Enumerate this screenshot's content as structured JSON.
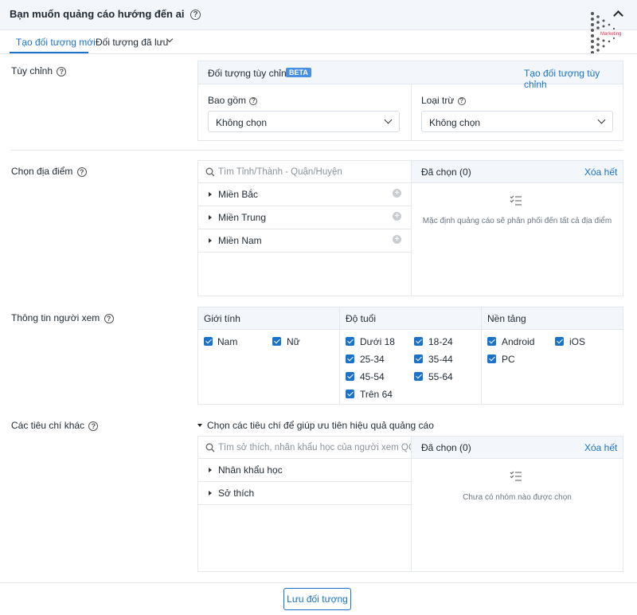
{
  "header": {
    "title": "Bạn muốn quảng cáo hướng đến ai",
    "logo_text": "Marketing"
  },
  "tabs": [
    {
      "label": "Tạo đối tượng mới"
    },
    {
      "label": "Đối tượng đã lưu"
    }
  ],
  "custom": {
    "label": "Tùy chỉnh",
    "panel_title": "Đối tượng tùy chỉnh",
    "badge": "BETA",
    "create_link": "Tạo đối tượng tùy chỉnh",
    "include_label": "Bao gồm",
    "include_value": "Không chọn",
    "exclude_label": "Loại trừ",
    "exclude_value": "Không chọn"
  },
  "location": {
    "label": "Chọn địa điểm",
    "search_placeholder": "Tìm Tỉnh/Thành - Quận/Huyện",
    "items": [
      "Miền Bắc",
      "Miền Trung",
      "Miền Nam"
    ],
    "selected_label": "Đã chọn (0)",
    "clear_label": "Xóa hết",
    "empty_text": "Mặc định quảng cáo sẽ phân phối đến tất cả địa điểm"
  },
  "viewer": {
    "label": "Thông tin người xem",
    "gender_title": "Giới tính",
    "genders": [
      "Nam",
      "Nữ"
    ],
    "age_title": "Độ tuổi",
    "ages": [
      "Dưới 18",
      "18-24",
      "25-34",
      "35-44",
      "45-54",
      "55-64",
      "Trên 64"
    ],
    "platform_title": "Nền tảng",
    "platforms": [
      "Android",
      "iOS",
      "PC"
    ]
  },
  "other": {
    "label": "Các tiêu chí khác",
    "toggle_text": "Chọn các tiêu chí để giúp ưu tiên hiệu quả quảng cáo",
    "search_placeholder": "Tìm sở thích, nhân khẩu học của người xem QC",
    "items": [
      "Nhân khẩu học",
      "Sở thích"
    ],
    "selected_label": "Đã chọn (0)",
    "clear_label": "Xóa hết",
    "empty_text": "Chưa có nhóm nào được chọn"
  },
  "footer": {
    "save_label": "Lưu đối tượng"
  },
  "colors": {
    "accent": "#1a73c8",
    "panel_head": "#f3f6fa",
    "border": "#e3e8ee"
  }
}
